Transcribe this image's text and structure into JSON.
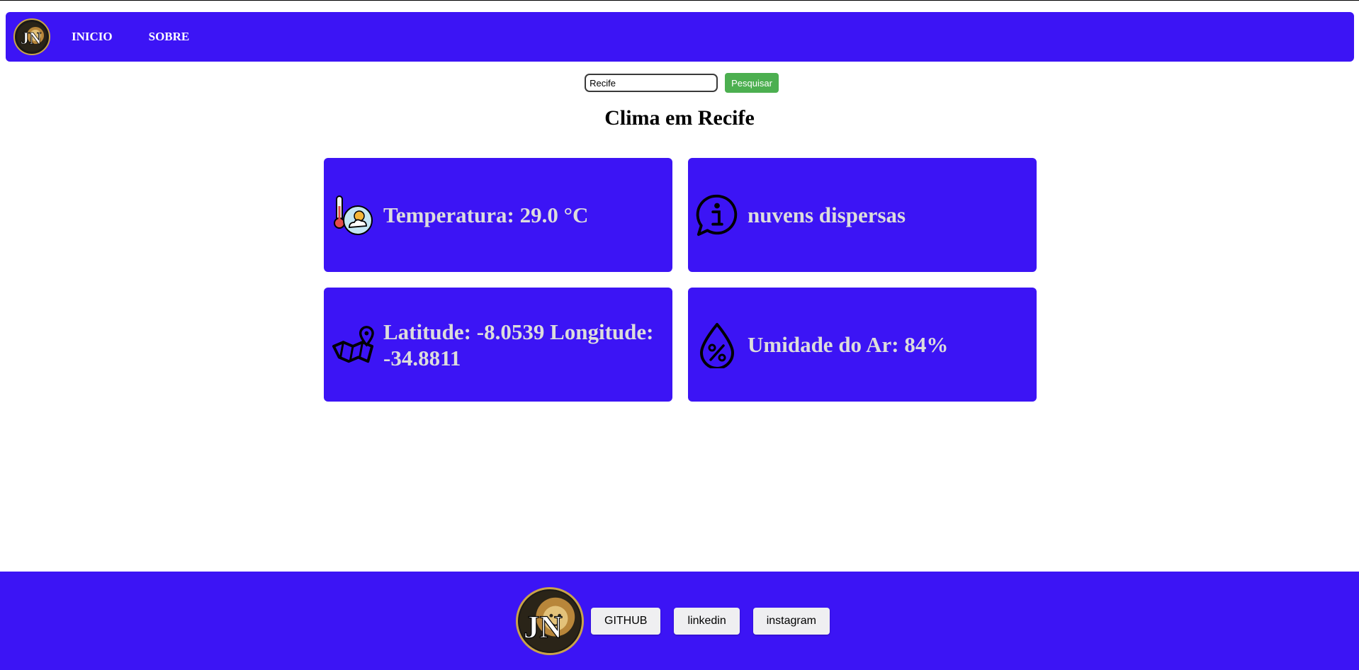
{
  "colors": {
    "accent": "#3c14f5",
    "button_green": "#4caf50",
    "card_text": "#dcdcdc"
  },
  "nav": {
    "logo_icon": "lion-jn-logo-icon",
    "links": [
      {
        "label": "INICIO"
      },
      {
        "label": "SOBRE"
      }
    ]
  },
  "search": {
    "value": "Recife",
    "button_label": "Pesquisar"
  },
  "page_title": "Clima em Recife",
  "cards": [
    {
      "icon": "thermometer-weather-icon",
      "text": "Temperatura: 29.0 °C"
    },
    {
      "icon": "info-bubble-icon",
      "text": "nuvens dispersas"
    },
    {
      "icon": "map-location-icon",
      "text": "Latitude: -8.0539 Longitude: -34.8811"
    },
    {
      "icon": "humidity-drop-icon",
      "text": "Umidade do Ar: 84%"
    }
  ],
  "footer": {
    "logo_icon": "lion-jn-logo-icon",
    "links": [
      {
        "label": "GITHUB"
      },
      {
        "label": "linkedin"
      },
      {
        "label": "instagram"
      }
    ]
  }
}
